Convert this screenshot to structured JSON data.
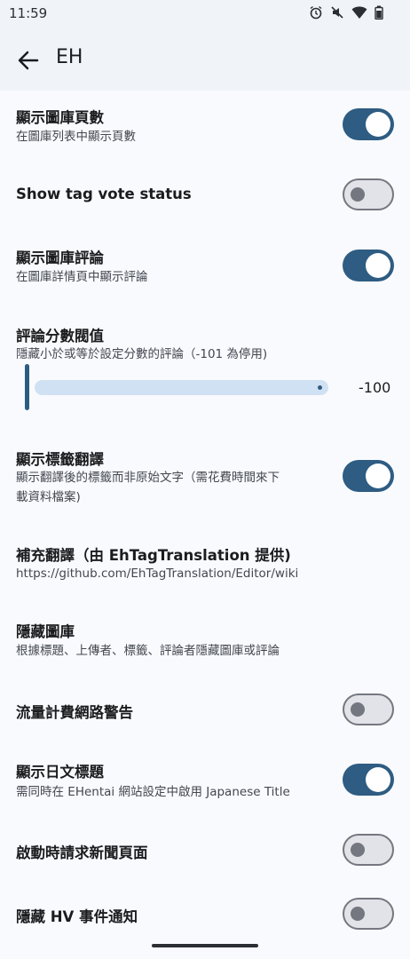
{
  "status_bar": {
    "time": "11:59",
    "icons": [
      "alarm-icon",
      "mute-icon",
      "wifi-icon",
      "battery-icon"
    ]
  },
  "top_bar": {
    "back_icon": "arrow-left-icon",
    "title": "EH"
  },
  "settings": {
    "show_gallery_pages": {
      "title": "顯示圖庫頁數",
      "summary": "在圖庫列表中顯示頁數",
      "checked": true
    },
    "show_tag_vote_status": {
      "title": "Show tag vote status",
      "checked": false
    },
    "show_gallery_comments": {
      "title": "顯示圖庫評論",
      "summary": "在圖庫詳情頁中顯示評論",
      "checked": true
    },
    "comment_threshold": {
      "title": "評論分數閥值",
      "summary": "隱藏小於或等於設定分數的評論（-101 為停用)",
      "value": "-100"
    },
    "show_tag_translations": {
      "title": "顯示標籤翻譯",
      "summary_line1": "顯示翻譯後的標籤而非原始文字（需花費時間來下",
      "summary_line2": "載資料檔案)",
      "checked": true
    },
    "tag_translation_source": {
      "title": "補充翻譯（由 EhTagTranslation 提供)",
      "summary": "https://github.com/EhTagTranslation/Editor/wiki"
    },
    "hidden_galleries": {
      "title": "隱藏圖庫",
      "summary": "根據標題、上傳者、標籤、評論者隱藏圖庫或評論"
    },
    "metered_network_warning": {
      "title": "流量計費網路警告",
      "checked": false
    },
    "show_japanese_title": {
      "title": "顯示日文標題",
      "summary": "需同時在 EHentai 網站設定中啟用 Japanese Title",
      "checked": true
    },
    "request_news_on_launch": {
      "title": "啟動時請求新聞頁面",
      "checked": false
    },
    "hide_hv_events": {
      "title": "隱藏 HV 事件通知",
      "checked": false
    }
  },
  "colors": {
    "accent": "#2e5c82",
    "switch_off_track": "#e1e3e8",
    "switch_off_outline": "#74777f",
    "background": "#f8fafe",
    "slider_track": "#cfe1f2"
  }
}
